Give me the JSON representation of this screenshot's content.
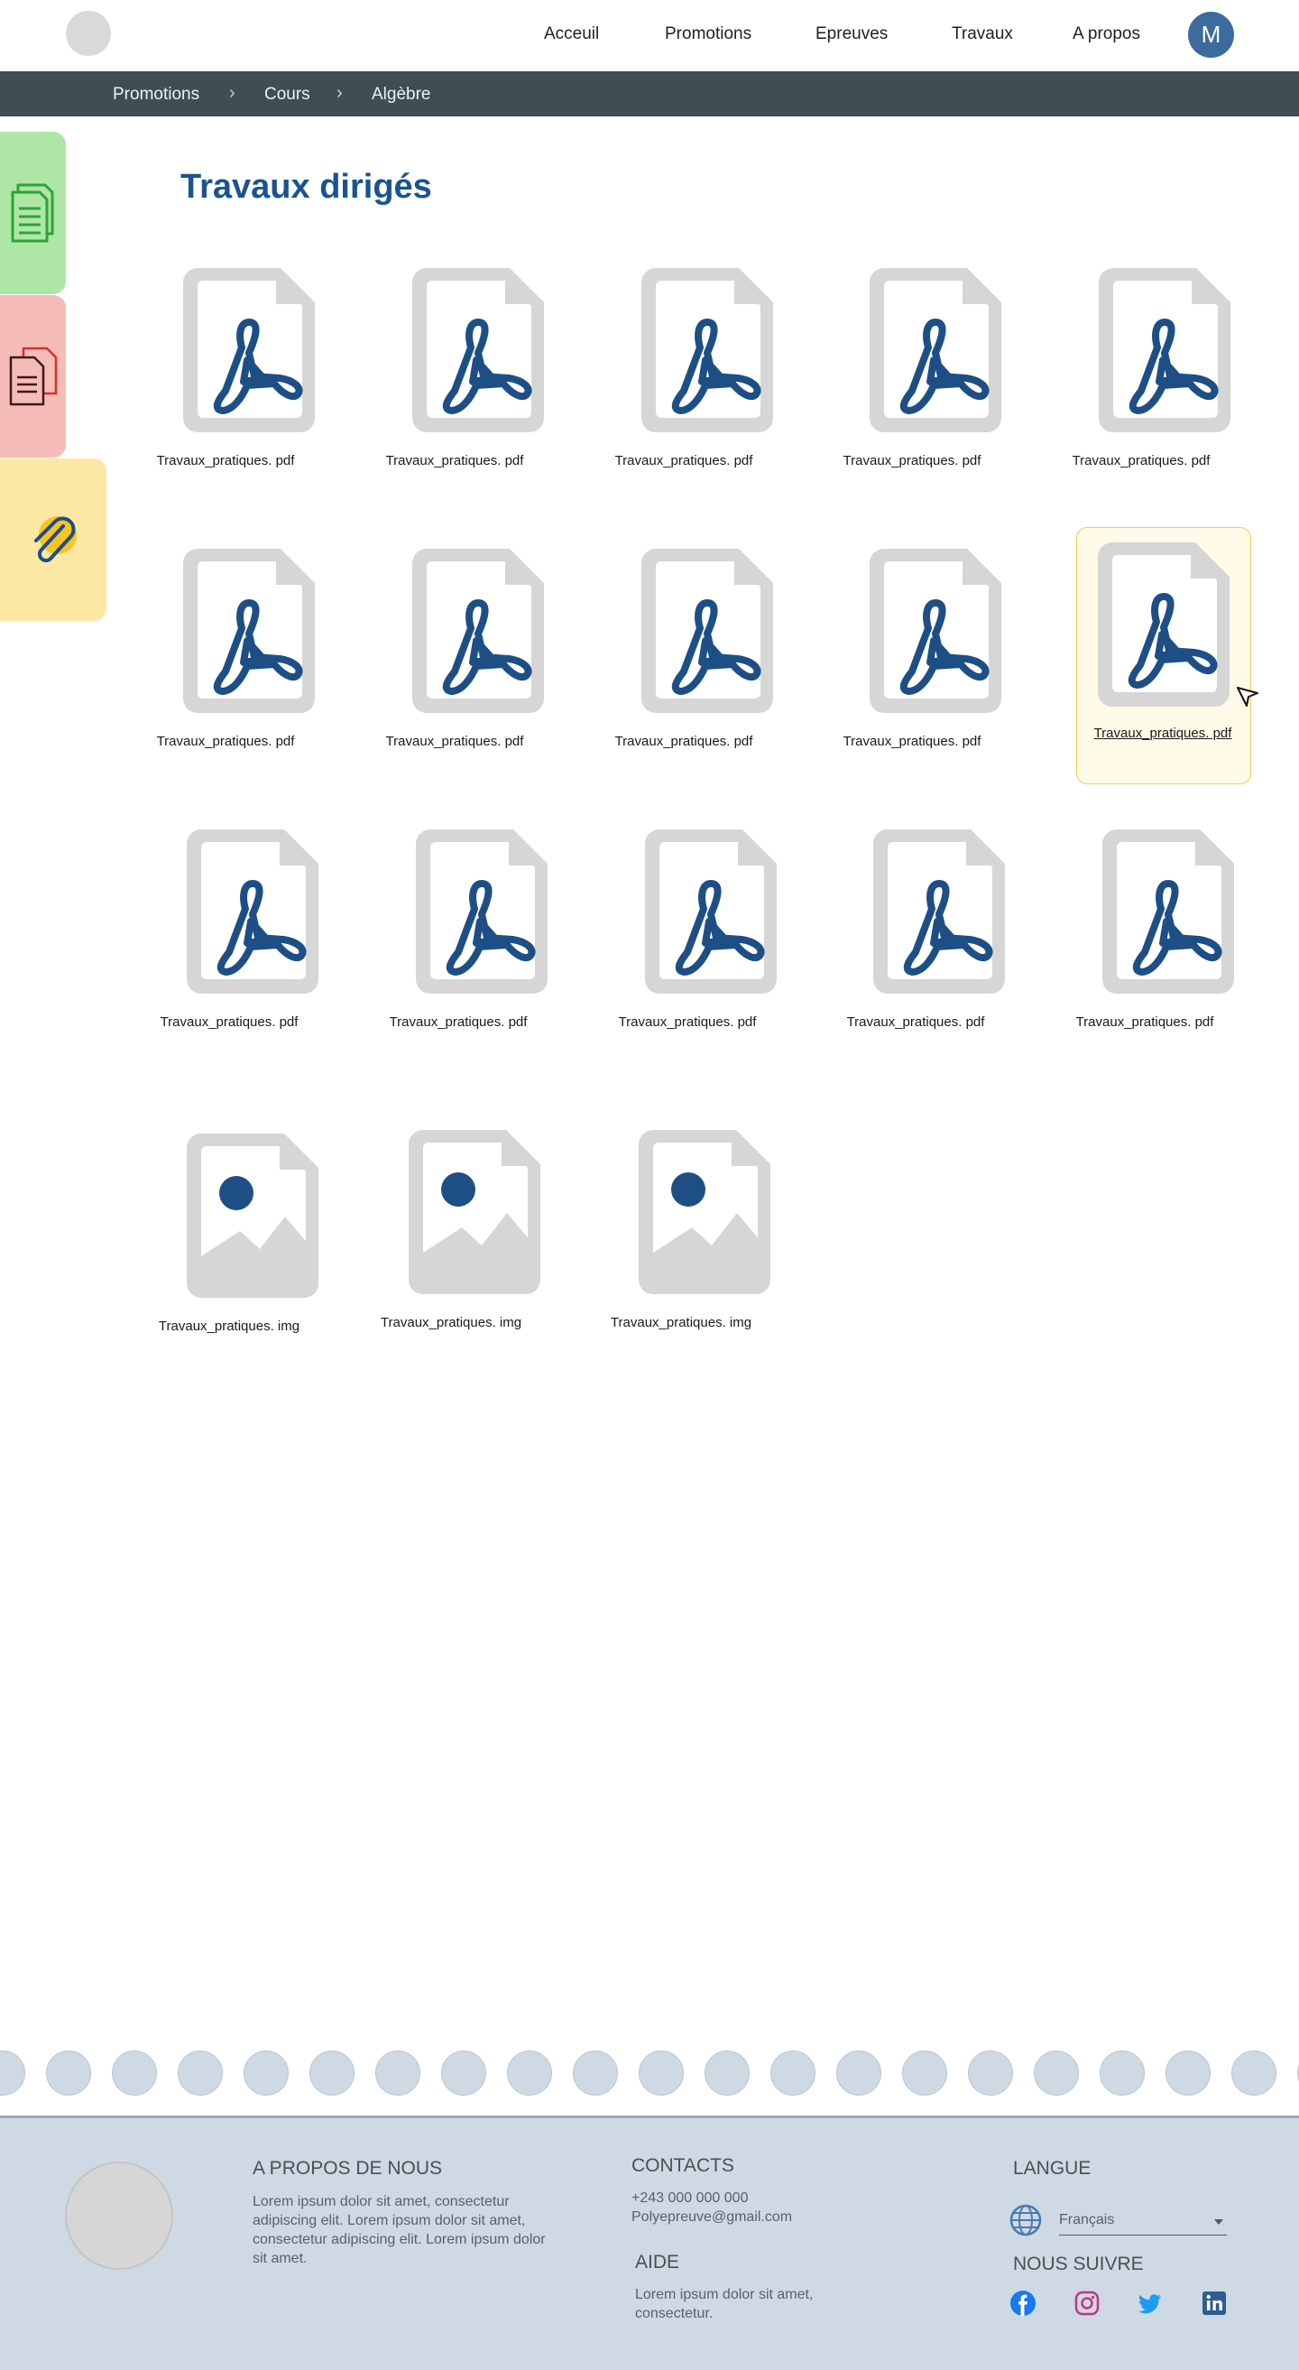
{
  "nav": {
    "links": [
      {
        "label": "Acceuil"
      },
      {
        "label": "Promotions"
      },
      {
        "label": "Epreuves"
      },
      {
        "label": "Travaux"
      },
      {
        "label": "A propos"
      }
    ],
    "avatar_letter": "M"
  },
  "breadcrumb": [
    "Promotions",
    "Cours",
    "Algèbre"
  ],
  "side_tabs": [
    {
      "icon": "documents-icon",
      "color": "#aee6a6"
    },
    {
      "icon": "pdf-documents-icon",
      "color": "#f6bcb7"
    },
    {
      "icon": "paperclip-icon",
      "color": "#fde7a4"
    }
  ],
  "page": {
    "title": "Travaux dirigés"
  },
  "files": [
    {
      "name": "Travaux_pratiques. pdf",
      "type": "pdf",
      "selected": false
    },
    {
      "name": "Travaux_pratiques. pdf",
      "type": "pdf",
      "selected": false
    },
    {
      "name": "Travaux_pratiques. pdf",
      "type": "pdf",
      "selected": false
    },
    {
      "name": "Travaux_pratiques. pdf",
      "type": "pdf",
      "selected": false
    },
    {
      "name": "Travaux_pratiques. pdf",
      "type": "pdf",
      "selected": false
    },
    {
      "name": "Travaux_pratiques. pdf",
      "type": "pdf",
      "selected": false
    },
    {
      "name": "Travaux_pratiques. pdf",
      "type": "pdf",
      "selected": false
    },
    {
      "name": "Travaux_pratiques. pdf",
      "type": "pdf",
      "selected": false
    },
    {
      "name": "Travaux_pratiques. pdf",
      "type": "pdf",
      "selected": false
    },
    {
      "name": "Travaux_pratiques. pdf",
      "type": "pdf",
      "selected": true
    },
    {
      "name": "Travaux_pratiques. pdf",
      "type": "pdf",
      "selected": false
    },
    {
      "name": "Travaux_pratiques. pdf",
      "type": "pdf",
      "selected": false
    },
    {
      "name": "Travaux_pratiques. pdf",
      "type": "pdf",
      "selected": false
    },
    {
      "name": "Travaux_pratiques. pdf",
      "type": "pdf",
      "selected": false
    },
    {
      "name": "Travaux_pratiques. pdf",
      "type": "pdf",
      "selected": false
    },
    {
      "name": "Travaux_pratiques. img",
      "type": "img",
      "selected": false
    },
    {
      "name": "Travaux_pratiques. img",
      "type": "img",
      "selected": false
    },
    {
      "name": "Travaux_pratiques. img",
      "type": "img",
      "selected": false
    }
  ],
  "footer": {
    "about_title": "A PROPOS DE NOUS",
    "about_text": "Lorem ipsum dolor sit amet, consectetur adipiscing elit. Lorem ipsum dolor sit amet, consectetur adipiscing elit. Lorem ipsum dolor sit amet.",
    "contacts_title": "CONTACTS",
    "phone": "+243 000 000 000",
    "email": "Polyepreuve@gmail.com",
    "help_title": "AIDE",
    "help_text": "Lorem ipsum dolor sit amet, consectetur.",
    "language_title": "LANGUE",
    "language_value": "Français",
    "follow_title": "NOUS SUIVRE",
    "socials": [
      "facebook-icon",
      "instagram-icon",
      "twitter-icon",
      "linkedin-icon"
    ]
  },
  "colors": {
    "accent": "#1a5490",
    "icon_blue": "#1d4f86",
    "breadcrumb_bg": "#3f4d55",
    "footer_bg": "#cfd9e3",
    "selected_bg": "#fffbe8",
    "selected_border": "#f3cf4a"
  }
}
